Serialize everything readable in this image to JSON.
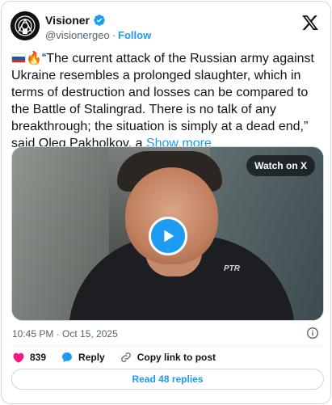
{
  "author": {
    "display_name": "Visioner",
    "handle": "@visionergeo",
    "separator": "·",
    "follow_label": "Follow"
  },
  "tweet": {
    "flag_emoji": "🇷🇺",
    "fire_emoji": "🔥",
    "text": "“The current attack of the Russian army against Ukraine resembles a prolonged slaughter, which in terms of destruction and losses can be compared to the Battle of Stalingrad. There is no talk of any breakthrough; the situation is simply at a dead end,” said Oleg Pakholkov, a",
    "show_more_label": "Show more"
  },
  "media": {
    "watch_label": "Watch on X",
    "chest_logo": "PTR"
  },
  "meta": {
    "timestamp": "10:45 PM · Oct 15, 2025"
  },
  "actions": {
    "like_count": "839",
    "reply_label": "Reply",
    "copy_link_label": "Copy link to post"
  },
  "footer": {
    "read_replies_label": "Read 48 replies"
  },
  "colors": {
    "accent": "#1d9bf0",
    "like": "#f91880",
    "text": "#0f1419",
    "muted": "#536471",
    "border": "#cfd9de"
  },
  "icons": [
    "avatar-icon",
    "verified-icon",
    "x-logo-icon",
    "play-icon",
    "info-icon",
    "heart-icon",
    "reply-icon",
    "link-icon"
  ]
}
